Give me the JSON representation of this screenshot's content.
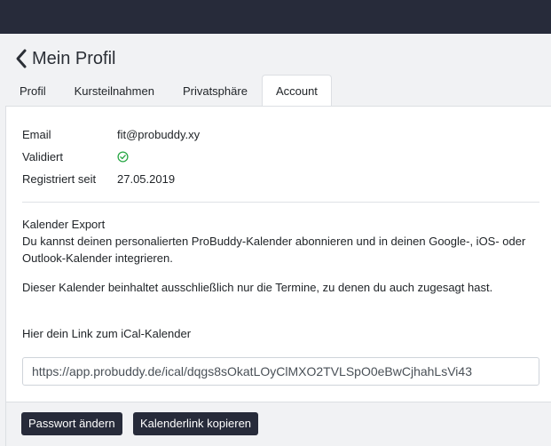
{
  "header": {
    "title": "Mein Profil",
    "back_icon": "chevron-left-icon"
  },
  "tabs": [
    {
      "label": "Profil"
    },
    {
      "label": "Kursteilnahmen"
    },
    {
      "label": "Privatsphäre"
    },
    {
      "label": "Account",
      "active": true
    }
  ],
  "account": {
    "email_label": "Email",
    "email_value": "fit@probuddy.xy",
    "validated_label": "Validiert",
    "validated_icon": "check-circle-icon",
    "registered_label": "Registriert seit",
    "registered_value": "27.05.2019"
  },
  "calendar": {
    "heading": "Kalender Export",
    "description": "Du kannst deinen personalierten ProBuddy-Kalender abonnieren und in deinen Google-, iOS- oder Outlook-Kalender integrieren.",
    "note": "Dieser Kalender beinhaltet ausschließlich nur die Termine, zu denen du auch zugesagt hast.",
    "link_intro": "Hier dein Link zum iCal-Kalender",
    "link_value": "https://app.probuddy.de/ical/dqgs8sOkatLOyClMXO2TVLSpO0eBwCjhahLsVi43"
  },
  "actions": {
    "change_password": "Passwort ändern",
    "copy_calendar_link": "Kalenderlink kopieren"
  },
  "colors": {
    "topbar": "#272b3a",
    "button": "#272b3a",
    "check": "#28a745"
  }
}
